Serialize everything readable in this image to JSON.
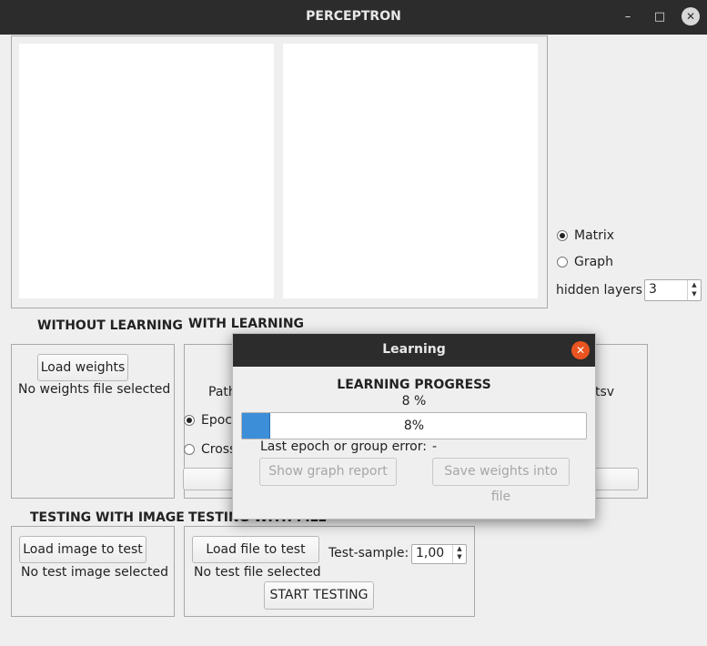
{
  "window": {
    "title": "PERCEPTRON"
  },
  "window_controls": {
    "minimize": "–",
    "maximize": "□",
    "close": "✕"
  },
  "view_mode": {
    "options": [
      {
        "label": "Matrix",
        "selected": true
      },
      {
        "label": "Graph",
        "selected": false
      }
    ],
    "hidden_layers_label": "hidden layers",
    "hidden_layers_value": "3"
  },
  "without_learning": {
    "heading": "WITHOUT LEARNING",
    "load_weights_button": "Load weights",
    "status": "No weights file selected"
  },
  "with_learning": {
    "heading": "WITH LEARNING",
    "path_label_fragment": "Path",
    "right_fragment": "tsv",
    "radio_epochs_fragment": "Epoc",
    "radio_cross_fragment": "Cross"
  },
  "testing_with_image": {
    "heading": "TESTING WITH IMAGE",
    "load_button": "Load image to test",
    "status": "No test image selected"
  },
  "testing_with_file": {
    "heading": "TESTING WITH FILE",
    "load_button": "Load file to test",
    "status": "No test file selected",
    "test_sample_label": "Test-sample:",
    "test_sample_value": "1,00",
    "start_button": "START TESTING"
  },
  "learning_dialog": {
    "title": "Learning",
    "close": "✕",
    "heading": "LEARNING PROGRESS",
    "percent_text": "8 %",
    "progress": {
      "value": 8,
      "label": "8%"
    },
    "error_label": "Last epoch or group error:",
    "error_value": "-",
    "show_graph_button": "Show graph report",
    "save_weights_button": "Save weights into file"
  },
  "colors": {
    "accent": "#3c8ed8",
    "titlebar": "#2c2c2c",
    "dialog_close": "#e95420"
  }
}
